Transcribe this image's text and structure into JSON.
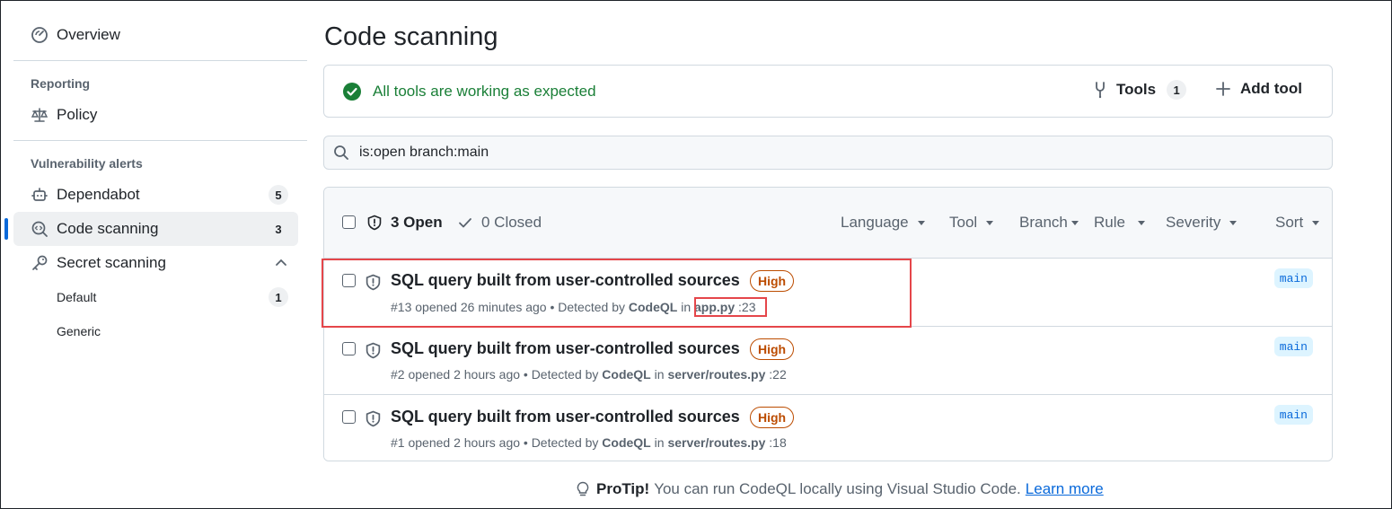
{
  "sidebar": {
    "overview": "Overview",
    "reporting_heading": "Reporting",
    "policy": "Policy",
    "vuln_heading": "Vulnerability alerts",
    "dependabot": {
      "label": "Dependabot",
      "count": "5"
    },
    "code_scanning": {
      "label": "Code scanning",
      "count": "3"
    },
    "secret_scanning": {
      "label": "Secret scanning"
    },
    "secret_sub": [
      {
        "label": "Default",
        "count": "1"
      },
      {
        "label": "Generic"
      }
    ]
  },
  "main": {
    "title": "Code scanning",
    "status_text": "All tools are working as expected",
    "tools_label": "Tools",
    "tools_count": "1",
    "add_tool_label": "Add tool",
    "search_value": "is:open branch:main",
    "open_label": "3 Open",
    "closed_label": "0 Closed",
    "filters": [
      "Language",
      "Tool",
      "Branch",
      "Rule",
      "Severity",
      "Sort"
    ],
    "alerts": [
      {
        "title": "SQL query built from user-controlled sources",
        "severity": "High",
        "meta_prefix": "#13 opened 26 minutes ago • Detected by ",
        "tool": "CodeQL",
        "in": " in ",
        "file": "app.py",
        "line": " :23",
        "branch": "main"
      },
      {
        "title": "SQL query built from user-controlled sources",
        "severity": "High",
        "meta_prefix": "#2 opened 2 hours ago • Detected by ",
        "tool": "CodeQL",
        "in": " in ",
        "file": "server/routes.py",
        "line": " :22",
        "branch": "main"
      },
      {
        "title": "SQL query built from user-controlled sources",
        "severity": "High",
        "meta_prefix": "#1 opened 2 hours ago • Detected by ",
        "tool": "CodeQL",
        "in": " in ",
        "file": "server/routes.py",
        "line": " :18",
        "branch": "main"
      }
    ],
    "protip": {
      "label": "ProTip!",
      "text": "You can run CodeQL locally using Visual Studio Code.",
      "link": "Learn more"
    }
  },
  "colors": {
    "accent": "#0969da",
    "success": "#1a7f37",
    "severity_high": "#bc4c00",
    "highlight": "#e5464a"
  }
}
